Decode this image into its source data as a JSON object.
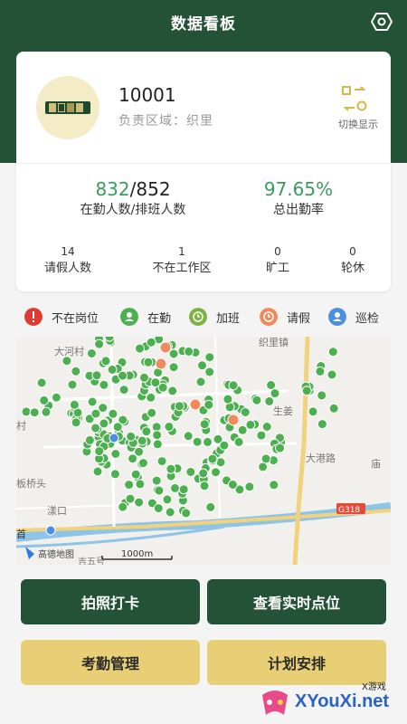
{
  "header": {
    "title": "数据看板",
    "icon": "hexagon-settings-icon"
  },
  "user": {
    "id": "10001",
    "region": "负责区域：织里",
    "switch_label": "切换显示"
  },
  "stats": {
    "on_duty": "832",
    "scheduled": "852",
    "on_duty_label": "在勤人数/排班人数",
    "attendance_rate": "97.65%",
    "attendance_label": "总出勤率",
    "leave": {
      "value": "14",
      "label": "请假人数"
    },
    "not_in_area": {
      "value": "1",
      "label": "不在工作区"
    },
    "absent": {
      "value": "0",
      "label": "旷工"
    },
    "rest": {
      "value": "0",
      "label": "轮休"
    }
  },
  "legend": [
    {
      "label": "不在岗位",
      "color": "#e03a34"
    },
    {
      "label": "在勤",
      "color": "#4caf50"
    },
    {
      "label": "加班",
      "color": "#7cb342"
    },
    {
      "label": "请假",
      "color": "#f08a5d"
    },
    {
      "label": "巡检",
      "color": "#4a8fe0"
    }
  ],
  "map": {
    "labels": [
      "大河村",
      "织里镇",
      "生姜",
      "村",
      "大港路",
      "板桥头",
      "漾口",
      "庙",
      "首",
      "G318",
      "吉五号"
    ],
    "logo": "高德地图",
    "scale": "1000m"
  },
  "buttons": {
    "checkin": "拍照打卡",
    "realtime": "查看实时点位",
    "attendance": "考勤管理",
    "plan": "计划安排"
  },
  "watermark": {
    "text": "XYouXi.net",
    "small": "X游戏"
  }
}
